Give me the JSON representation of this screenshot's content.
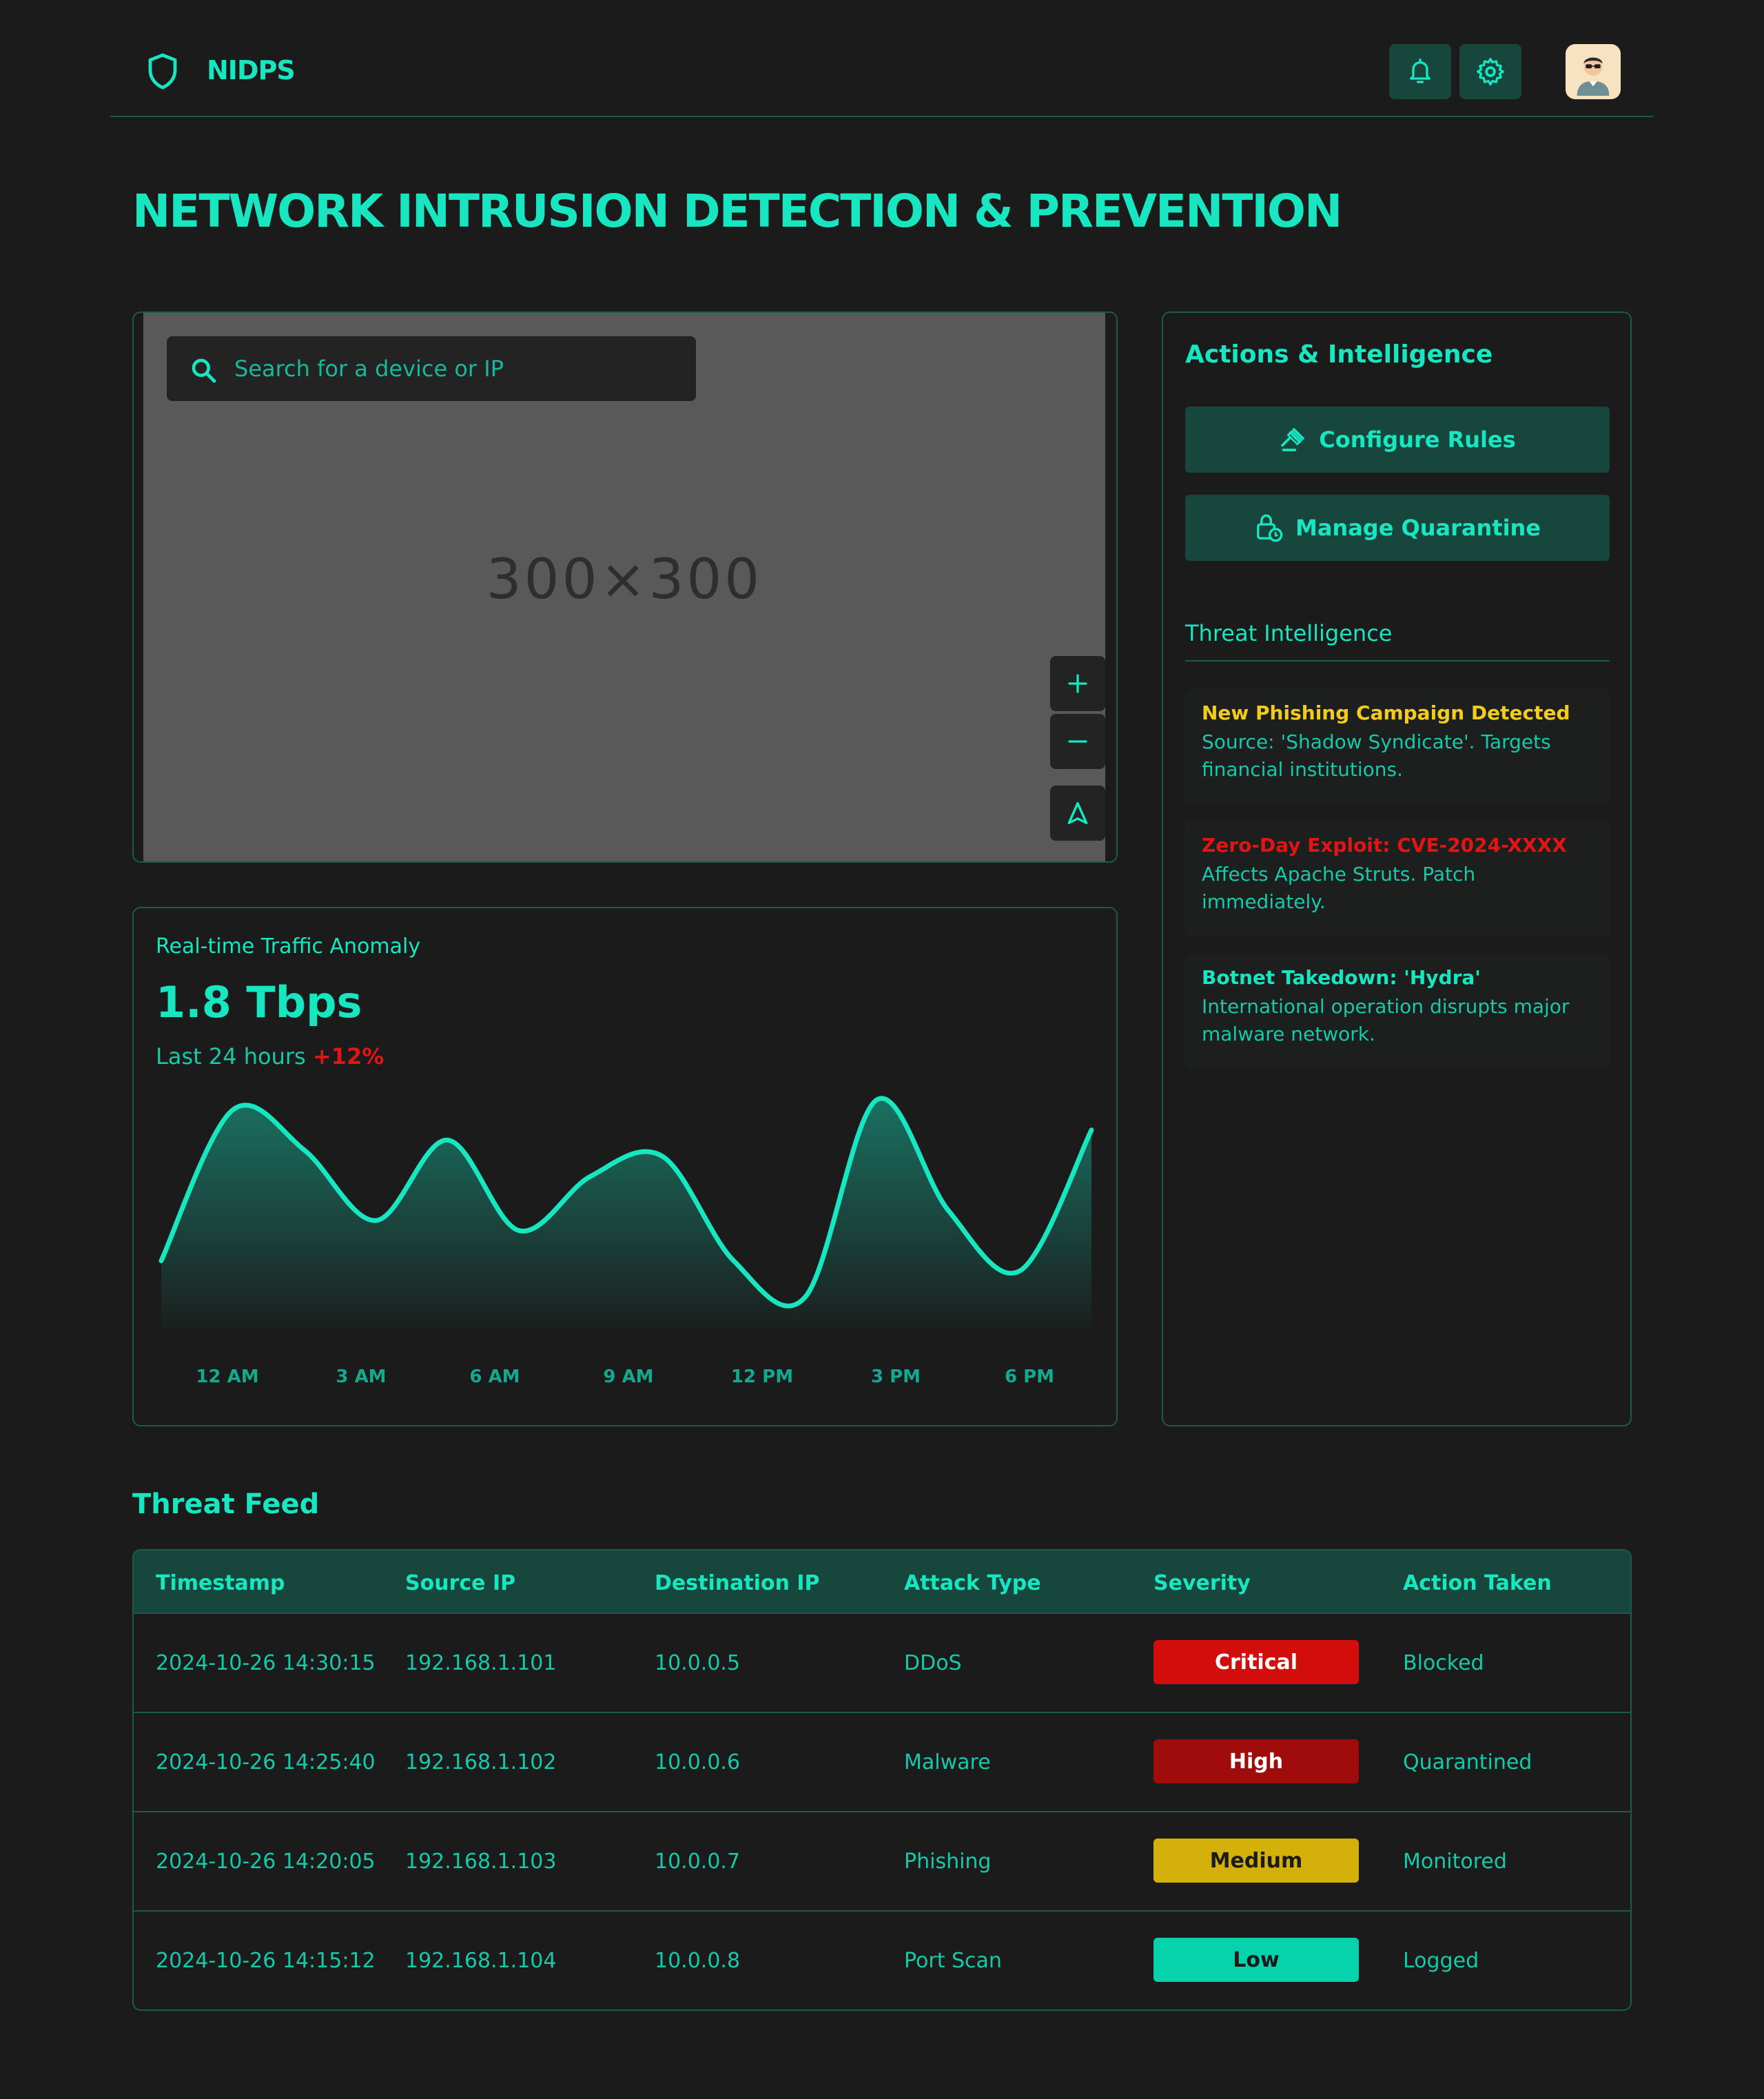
{
  "app": {
    "brand": "NIDPS",
    "page_title": "NETWORK INTRUSION DETECTION & PREVENTION"
  },
  "header": {
    "icons": [
      "shield-icon",
      "bell-icon",
      "gear-icon",
      "avatar"
    ]
  },
  "map": {
    "search_placeholder": "Search for a device or IP",
    "placeholder_text": "300×300",
    "controls": [
      "zoom-in-icon",
      "zoom-out-icon",
      "navigation-arrow-icon"
    ]
  },
  "traffic": {
    "title": "Real-time Traffic Anomaly",
    "value": "1.8 Tbps",
    "period": "Last 24 hours",
    "change": "+12%",
    "change_color": "#e21414"
  },
  "chart_data": {
    "type": "area",
    "x_ticks": [
      "12 AM",
      "3 AM",
      "6 AM",
      "9 AM",
      "12 PM",
      "3 PM",
      "6 PM"
    ],
    "values": [
      0.2,
      0.95,
      0.75,
      0.4,
      0.8,
      0.35,
      0.62,
      0.72,
      0.2,
      0.02,
      1.0,
      0.45,
      0.15,
      0.85
    ],
    "ylim": [
      0,
      1
    ],
    "line_color": "#17e6c1",
    "grid": false
  },
  "actions": {
    "title": "Actions & Intelligence",
    "configure_rules": "Configure Rules",
    "manage_quarantine": "Manage Quarantine"
  },
  "intel": {
    "title": "Threat Intelligence",
    "items": [
      {
        "title": "New Phishing Campaign Detected",
        "body": "Source: 'Shadow Syndicate'. Targets financial institutions.",
        "color": "#f2cc1b"
      },
      {
        "title": "Zero-Day Exploit: CVE-2024-XXXX",
        "body": "Affects Apache Struts. Patch immediately.",
        "color": "#e21414"
      },
      {
        "title": "Botnet Takedown: 'Hydra'",
        "body": "International operation disrupts major malware network.",
        "color": "#17e6c1"
      }
    ]
  },
  "feed": {
    "title": "Threat Feed",
    "columns": [
      "Timestamp",
      "Source IP",
      "Destination IP",
      "Attack Type",
      "Severity",
      "Action Taken"
    ],
    "rows": [
      {
        "timestamp": "2024-10-26 14:30:15",
        "source": "192.168.1.101",
        "dest": "10.0.0.5",
        "attack": "DDoS",
        "severity": "Critical",
        "action": "Blocked",
        "sev_bg": "#d30c0c",
        "sev_fg": "#ffffff"
      },
      {
        "timestamp": "2024-10-26 14:25:40",
        "source": "192.168.1.102",
        "dest": "10.0.0.6",
        "attack": "Malware",
        "severity": "High",
        "action": "Quarantined",
        "sev_bg": "#a00b0b",
        "sev_fg": "#ffffff"
      },
      {
        "timestamp": "2024-10-26 14:20:05",
        "source": "192.168.1.103",
        "dest": "10.0.0.7",
        "attack": "Phishing",
        "severity": "Medium",
        "action": "Monitored",
        "sev_bg": "#d4b10a",
        "sev_fg": "#1b1b1b"
      },
      {
        "timestamp": "2024-10-26 14:15:12",
        "source": "192.168.1.104",
        "dest": "10.0.0.8",
        "attack": "Port Scan",
        "severity": "Low",
        "action": "Logged",
        "sev_bg": "#06d3ac",
        "sev_fg": "#1b1b1b"
      }
    ]
  }
}
